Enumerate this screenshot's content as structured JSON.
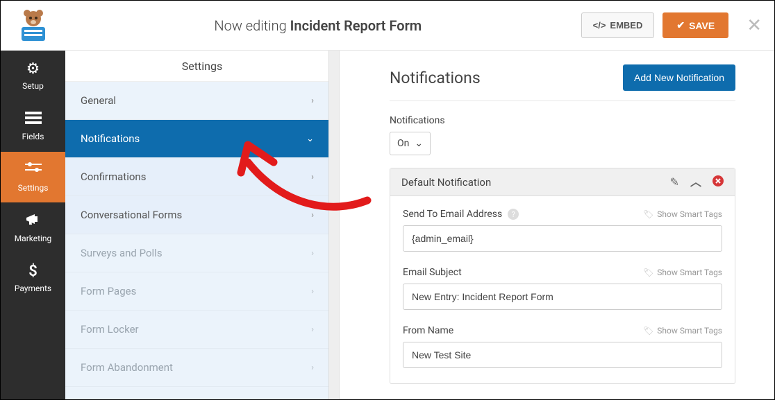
{
  "header": {
    "editing_label": "Now editing",
    "form_name": "Incident Report Form",
    "embed_label": "EMBED",
    "save_label": "SAVE"
  },
  "sidebar": {
    "items": [
      {
        "label": "Setup"
      },
      {
        "label": "Fields"
      },
      {
        "label": "Settings"
      },
      {
        "label": "Marketing"
      },
      {
        "label": "Payments"
      }
    ]
  },
  "section_title": "Settings",
  "subnav": {
    "items": [
      {
        "label": "General",
        "chev": "›",
        "type": "norm"
      },
      {
        "label": "Notifications",
        "chev": "⌄",
        "type": "selected"
      },
      {
        "label": "Confirmations",
        "chev": "›",
        "type": "sub"
      },
      {
        "label": "Conversational Forms",
        "chev": "›",
        "type": "sub"
      },
      {
        "label": "Surveys and Polls",
        "chev": "›",
        "type": "faded"
      },
      {
        "label": "Form Pages",
        "chev": "›",
        "type": "faded"
      },
      {
        "label": "Form Locker",
        "chev": "›",
        "type": "faded"
      },
      {
        "label": "Form Abandonment",
        "chev": "›",
        "type": "faded"
      }
    ]
  },
  "panel": {
    "heading": "Notifications",
    "add_button": "Add New Notification",
    "toggle_label": "Notifications",
    "toggle_value": "On",
    "card": {
      "title": "Default Notification",
      "smart_tags_label": "Show Smart Tags",
      "fields": [
        {
          "label": "Send To Email Address",
          "value": "{admin_email}",
          "help": true
        },
        {
          "label": "Email Subject",
          "value": "New Entry: Incident Report Form",
          "help": false
        },
        {
          "label": "From Name",
          "value": "New Test Site",
          "help": false
        }
      ]
    }
  }
}
